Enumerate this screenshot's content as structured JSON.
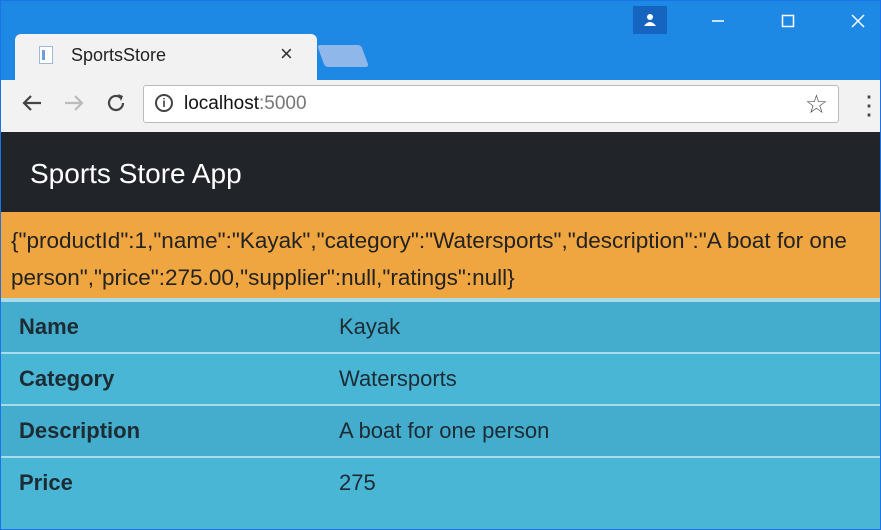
{
  "browser": {
    "tab_title": "SportsStore",
    "tab_close": "×",
    "url_host": "localhost",
    "url_port": ":5000",
    "accent": "#1e88e5"
  },
  "page": {
    "app_title": "Sports Store App",
    "json_text": "{\"productId\":1,\"name\":\"Kayak\",\"category\":\"Watersports\",\"description\":\"A boat for one person\",\"price\":275.00,\"supplier\":null,\"ratings\":null}",
    "navbar_color": "#212529",
    "json_bg_color": "#f0a640",
    "table_bg_color": "#4ab6d6",
    "rows": [
      {
        "label": "Name",
        "value": "Kayak"
      },
      {
        "label": "Category",
        "value": "Watersports"
      },
      {
        "label": "Description",
        "value": "A boat for one person"
      },
      {
        "label": "Price",
        "value": "275"
      }
    ]
  },
  "icons": [
    "page-favicon-icon",
    "user-icon",
    "back-arrow-icon",
    "forward-arrow-icon",
    "reload-icon",
    "info-icon",
    "star-icon",
    "menu-dots-icon"
  ]
}
